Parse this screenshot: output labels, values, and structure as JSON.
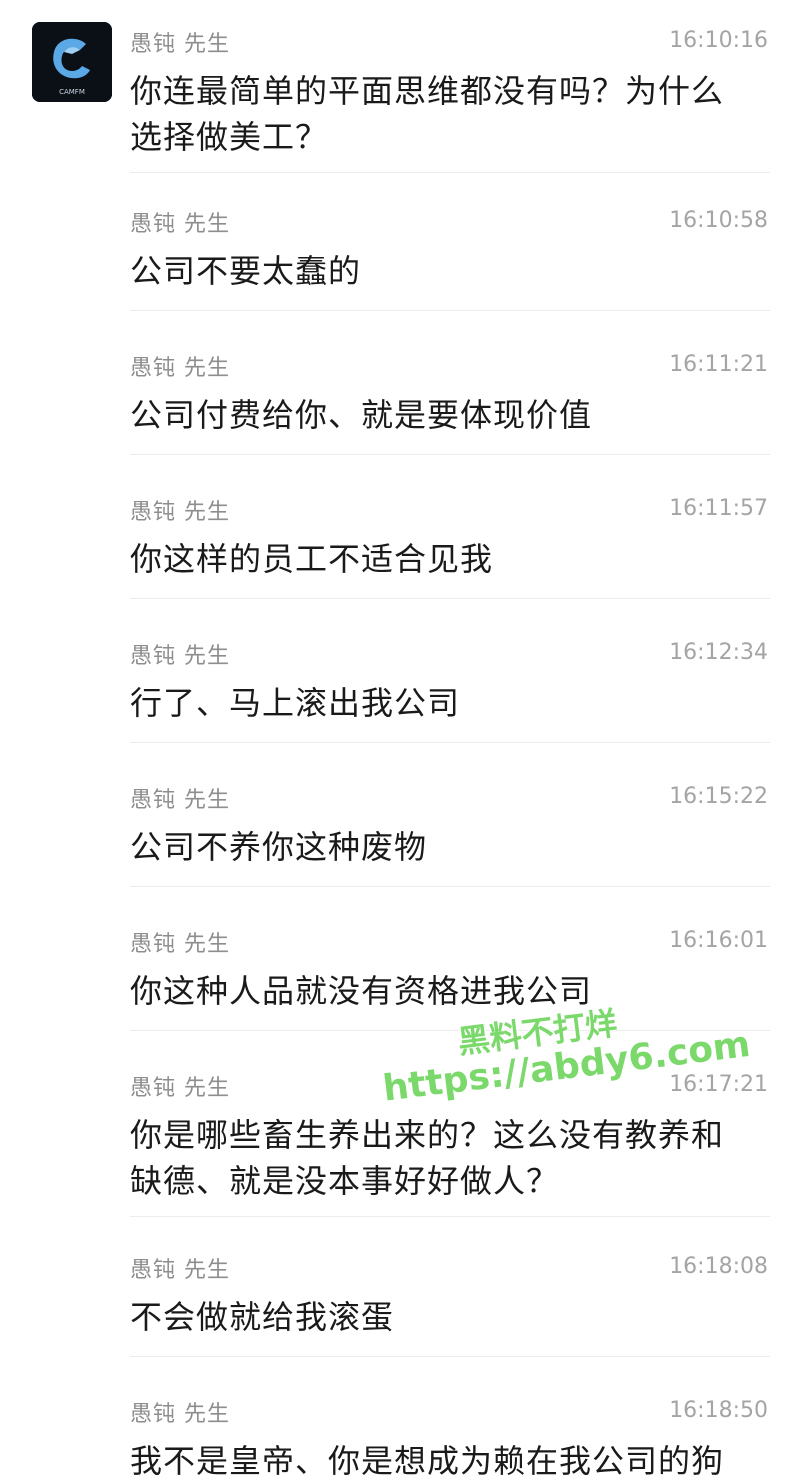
{
  "sender_name": "愚钝 先生",
  "avatar": {
    "icon": "camfm-logo",
    "logo_text": "CAMFM",
    "background": "#0b0f16",
    "accent": "#5aa9e6"
  },
  "messages": [
    {
      "sender": "愚钝 先生",
      "time": "16:10:16",
      "text": "你连最简单的平面思维都没有吗？为什么选择做美工？"
    },
    {
      "sender": "愚钝 先生",
      "time": "16:10:58",
      "text": "公司不要太蠢的"
    },
    {
      "sender": "愚钝 先生",
      "time": "16:11:21",
      "text": "公司付费给你、就是要体现价值"
    },
    {
      "sender": "愚钝 先生",
      "time": "16:11:57",
      "text": "你这样的员工不适合见我"
    },
    {
      "sender": "愚钝 先生",
      "time": "16:12:34",
      "text": "行了、马上滚出我公司"
    },
    {
      "sender": "愚钝 先生",
      "time": "16:15:22",
      "text": "公司不养你这种废物"
    },
    {
      "sender": "愚钝 先生",
      "time": "16:16:01",
      "text": "你这种人品就没有资格进我公司"
    },
    {
      "sender": "愚钝 先生",
      "time": "16:17:21",
      "text": "你是哪些畜生养出来的？这么没有教养和缺德、就是没本事好好做人？"
    },
    {
      "sender": "愚钝 先生",
      "time": "16:18:08",
      "text": "不会做就给我滚蛋"
    },
    {
      "sender": "愚钝 先生",
      "time": "16:18:50",
      "text": "我不是皇帝、你是想成为赖在我公司的狗"
    }
  ],
  "watermark": {
    "line1": "黑料不打烊",
    "line2": "https://abdy6.com",
    "color": "#7bd96c"
  },
  "colors": {
    "text": "#1a1a1a",
    "meta": "#8e8e8e",
    "divider": "#ececec"
  }
}
